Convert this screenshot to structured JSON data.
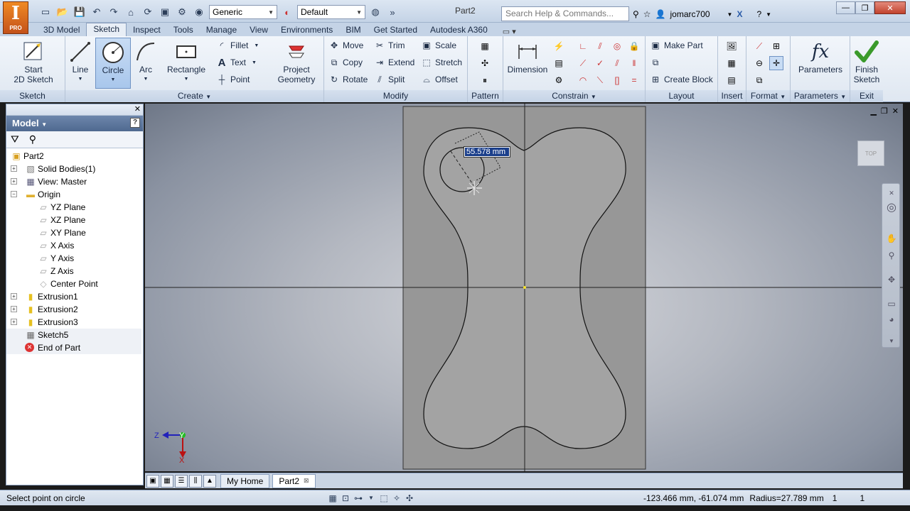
{
  "app": {
    "logo_letter": "I",
    "logo_sub": "PRO",
    "document_title": "Part2",
    "material": "Generic",
    "appearance": "Default",
    "search_placeholder": "Search Help & Commands...",
    "user": "jomarc700",
    "accent": "#f08a24"
  },
  "tabs": [
    "3D Model",
    "Sketch",
    "Inspect",
    "Tools",
    "Manage",
    "View",
    "Environments",
    "BIM",
    "Get Started",
    "Autodesk A360"
  ],
  "active_tab": "Sketch",
  "ribbon": {
    "sketch_panel": {
      "label": "Sketch",
      "start_sketch_1": "Start",
      "start_sketch_2": "2D Sketch"
    },
    "create_panel": {
      "label": "Create",
      "line": "Line",
      "circle": "Circle",
      "arc": "Arc",
      "rectangle": "Rectangle",
      "fillet": "Fillet",
      "text": "Text",
      "point": "Point",
      "project_geometry_1": "Project",
      "project_geometry_2": "Geometry"
    },
    "modify_panel": {
      "label": "Modify",
      "move": "Move",
      "copy": "Copy",
      "rotate": "Rotate",
      "trim": "Trim",
      "extend": "Extend",
      "split": "Split",
      "scale": "Scale",
      "stretch": "Stretch",
      "offset": "Offset"
    },
    "pattern_panel": {
      "label": "Pattern"
    },
    "constrain_panel": {
      "label": "Constrain",
      "dimension": "Dimension"
    },
    "layout_panel": {
      "label": "Layout",
      "make_part": "Make Part",
      "create_block": "Create Block"
    },
    "insert_panel": {
      "label": "Insert"
    },
    "format_panel": {
      "label": "Format"
    },
    "parameters_panel": {
      "label": "Parameters",
      "parameters": "Parameters"
    },
    "exit_panel": {
      "label": "Exit",
      "finish_1": "Finish",
      "finish_2": "Sketch"
    }
  },
  "browser": {
    "title": "Model",
    "items": [
      {
        "label": "Part2",
        "level": 0,
        "expander": "",
        "icon": "part-icon"
      },
      {
        "label": "Solid Bodies(1)",
        "level": 1,
        "expander": "+",
        "icon": "solid-bodies-icon"
      },
      {
        "label": "View: Master",
        "level": 1,
        "expander": "+",
        "icon": "view-icon"
      },
      {
        "label": "Origin",
        "level": 1,
        "expander": "-",
        "icon": "folder-icon"
      },
      {
        "label": "YZ Plane",
        "level": 2,
        "expander": "",
        "icon": "plane-icon"
      },
      {
        "label": "XZ Plane",
        "level": 2,
        "expander": "",
        "icon": "plane-icon"
      },
      {
        "label": "XY Plane",
        "level": 2,
        "expander": "",
        "icon": "plane-icon"
      },
      {
        "label": "X Axis",
        "level": 2,
        "expander": "",
        "icon": "axis-icon"
      },
      {
        "label": "Y Axis",
        "level": 2,
        "expander": "",
        "icon": "axis-icon"
      },
      {
        "label": "Z Axis",
        "level": 2,
        "expander": "",
        "icon": "axis-icon"
      },
      {
        "label": "Center Point",
        "level": 2,
        "expander": "",
        "icon": "center-point-icon"
      },
      {
        "label": "Extrusion1",
        "level": 1,
        "expander": "+",
        "icon": "extrusion-icon"
      },
      {
        "label": "Extrusion2",
        "level": 1,
        "expander": "+",
        "icon": "extrusion-icon"
      },
      {
        "label": "Extrusion3",
        "level": 1,
        "expander": "+",
        "icon": "extrusion-icon"
      },
      {
        "label": "Sketch5",
        "level": 1,
        "expander": "",
        "icon": "sketch-icon"
      },
      {
        "label": "End of Part",
        "level": 1,
        "expander": "",
        "icon": "end-of-part-icon"
      }
    ]
  },
  "viewport": {
    "dimension_value": "55.578 mm",
    "viewcube_label": "TOP",
    "triad_x": "X",
    "triad_y": "Y",
    "triad_z": "Z"
  },
  "doc_tabs": [
    "My Home",
    "Part2"
  ],
  "active_doc_tab": "Part2",
  "status": {
    "prompt": "Select point on circle",
    "coords": "-123.466 mm, -61.074 mm",
    "radius": "Radius=27.789 mm",
    "count1": "1",
    "count2": "1"
  }
}
